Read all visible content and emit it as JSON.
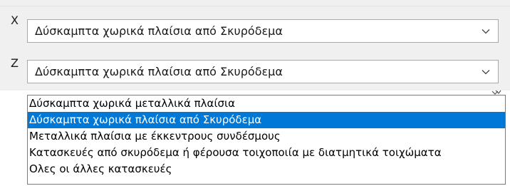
{
  "axes": [
    {
      "label": "X",
      "value": "Δύσκαμπτα χωρικά πλαίσια από Σκυρόδεμα"
    },
    {
      "label": "Z",
      "value": "Δύσκαμπτα χωρικά πλαίσια από Σκυρόδεμα"
    }
  ],
  "dropdown": {
    "options": [
      "Δύσκαμπτα χωρικά μεταλλικά πλαίσια",
      "Δύσκαμπτα χωρικά πλαίσια από Σκυρόδεμα",
      "Μεταλλικά πλαίσια με έκκεντρους συνδέσμους",
      "Κατασκευές από σκυρόδεμα ή φέρουσα τοιχοποιία με διατμητικά τοιχώματα",
      "Ολες οι άλλες κατασκευές"
    ],
    "selected_index": 1
  },
  "icons": {
    "combo_arrow": "chevron-down-icon",
    "cursor": "mouse-cursor-icon"
  },
  "colors": {
    "selection": "#0078d7",
    "panel_background": "#f0f0f0"
  }
}
